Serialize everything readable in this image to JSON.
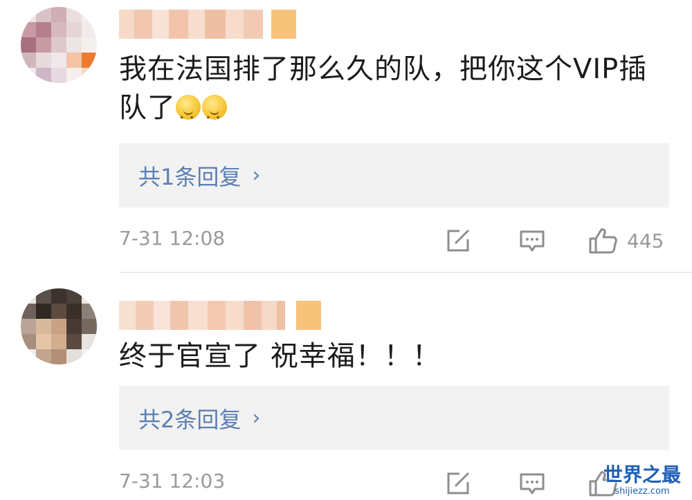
{
  "comments": [
    {
      "text_lines": [
        "我在法国排了那么久的队，把你这个VIP插",
        "队了"
      ],
      "emojis": [
        "grin-emoji",
        "grin-emoji"
      ],
      "reply_label": "共1条回复",
      "time": "7-31 12:08",
      "likes": "445"
    },
    {
      "text_lines": [
        "终于官宣了 祝幸福！！！"
      ],
      "reply_label": "共2条回复",
      "time": "7-31 12:03"
    }
  ],
  "icons": {
    "share": "share-icon",
    "comment": "comment-icon",
    "like": "thumb-up-icon",
    "chevron": "chevron-right-icon"
  },
  "colors": {
    "link": "#5b7fb0",
    "meta": "#999999",
    "reply_bg": "#f2f2f2"
  },
  "watermark": {
    "title": "世界之最",
    "subtitle": "shijiezz.com"
  }
}
